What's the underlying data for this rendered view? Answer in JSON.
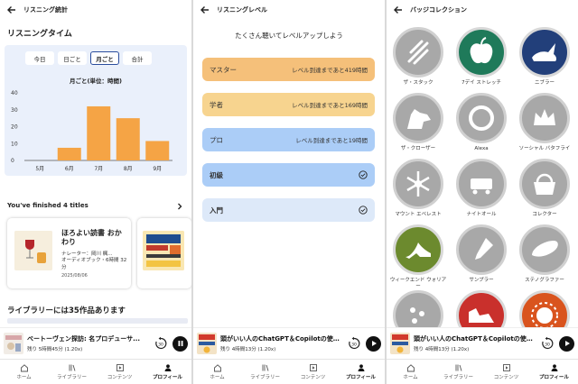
{
  "screen1": {
    "header": "リスニング統計",
    "listening_title": "リスニングタイム",
    "segments": [
      "今日",
      "日ごと",
      "月ごと",
      "合計"
    ],
    "active_segment": 2,
    "finished_title": "You've finished 4 titles",
    "book": {
      "title": "ほろよい読書 おかわり",
      "narrator": "ナレーター：岡川 楓...",
      "format": "オーディオブック・6時間 32分",
      "date": "2025/08/06"
    },
    "library_title": "ライブラリーには35作品あります"
  },
  "chart_data": {
    "type": "bar",
    "title": "月ごと(単位：時間)",
    "categories": [
      "5月",
      "6月",
      "7月",
      "8月",
      "9月"
    ],
    "values": [
      0,
      7.5,
      32,
      25,
      11.5
    ],
    "ylim": [
      0,
      40
    ],
    "yticks": [
      "40",
      "30",
      "20",
      "10",
      "0"
    ],
    "grid": false,
    "bar_color": "#f5a445"
  },
  "screen2": {
    "header": "リスニングレベル",
    "headline": "たくさん聴いてレベルアップしよう",
    "levels": [
      {
        "name": "マスター",
        "desc": "レベル到達まであと419時間",
        "color": "#f5c07a"
      },
      {
        "name": "学者",
        "desc": "レベル到達まであと169時間",
        "color": "#f7d48f"
      },
      {
        "name": "プロ",
        "desc": "レベル到達まであと19時間",
        "color": "#abcdf7"
      },
      {
        "name": "初級",
        "desc": "",
        "color": "#abcdf7"
      },
      {
        "name": "入門",
        "desc": "",
        "color": "#dde9f9"
      }
    ]
  },
  "screen3": {
    "header": "バッジコレクション",
    "badges": [
      {
        "label": "ザ・スタック",
        "icon": "books-icon",
        "earned": false
      },
      {
        "label": "7デイ ストレッチ",
        "icon": "apple-icon",
        "earned": true
      },
      {
        "label": "ニブラー",
        "icon": "rabbit-icon",
        "earned": true
      },
      {
        "label": "ザ・クローザー",
        "icon": "wolf-icon",
        "earned": false
      },
      {
        "label": "Alexa",
        "icon": "alexa-ring-icon",
        "earned": false
      },
      {
        "label": "ソーシャル バタフライ",
        "icon": "crown-icon",
        "earned": false
      },
      {
        "label": "マウント エベレスト",
        "icon": "snowflake-icon",
        "earned": false
      },
      {
        "label": "ナイトオール",
        "icon": "train-icon",
        "earned": false
      },
      {
        "label": "コレクター",
        "icon": "basket-icon",
        "earned": false
      },
      {
        "label": "ウィークエンド ウォリアー",
        "icon": "high-heel-icon",
        "earned": true
      },
      {
        "label": "サンプラー",
        "icon": "dropper-icon",
        "earned": false
      },
      {
        "label": "ステノグラファー",
        "icon": "bread-icon",
        "earned": false
      },
      {
        "label": "",
        "icon": "dots-icon",
        "earned": false
      },
      {
        "label": "",
        "icon": "winged-shoe-icon",
        "earned": true
      },
      {
        "label": "",
        "icon": "sun-icon",
        "earned": true
      }
    ]
  },
  "miniplayers": [
    {
      "title": "ベートーヴェン探訪: 名プロデューサ...",
      "status": "残り 5時間45分 (1.20x)"
    },
    {
      "title": "頭がいい人のChatGPT＆Copilotの使い...",
      "status": "残り 4時間13分 (1.20x)"
    },
    {
      "title": "頭がいい人のChatGPT＆Copilotの使い...",
      "status": "残り 4時間13分 (1.20x)"
    }
  ],
  "nav": [
    "ホーム",
    "ライブラリー",
    "コンテンツ",
    "プロフィール"
  ],
  "nav_active": 3,
  "colors": {
    "accent_blue": "#2a4c9c",
    "bar": "#f5a445",
    "badge_gray": "#a8a8a8"
  }
}
